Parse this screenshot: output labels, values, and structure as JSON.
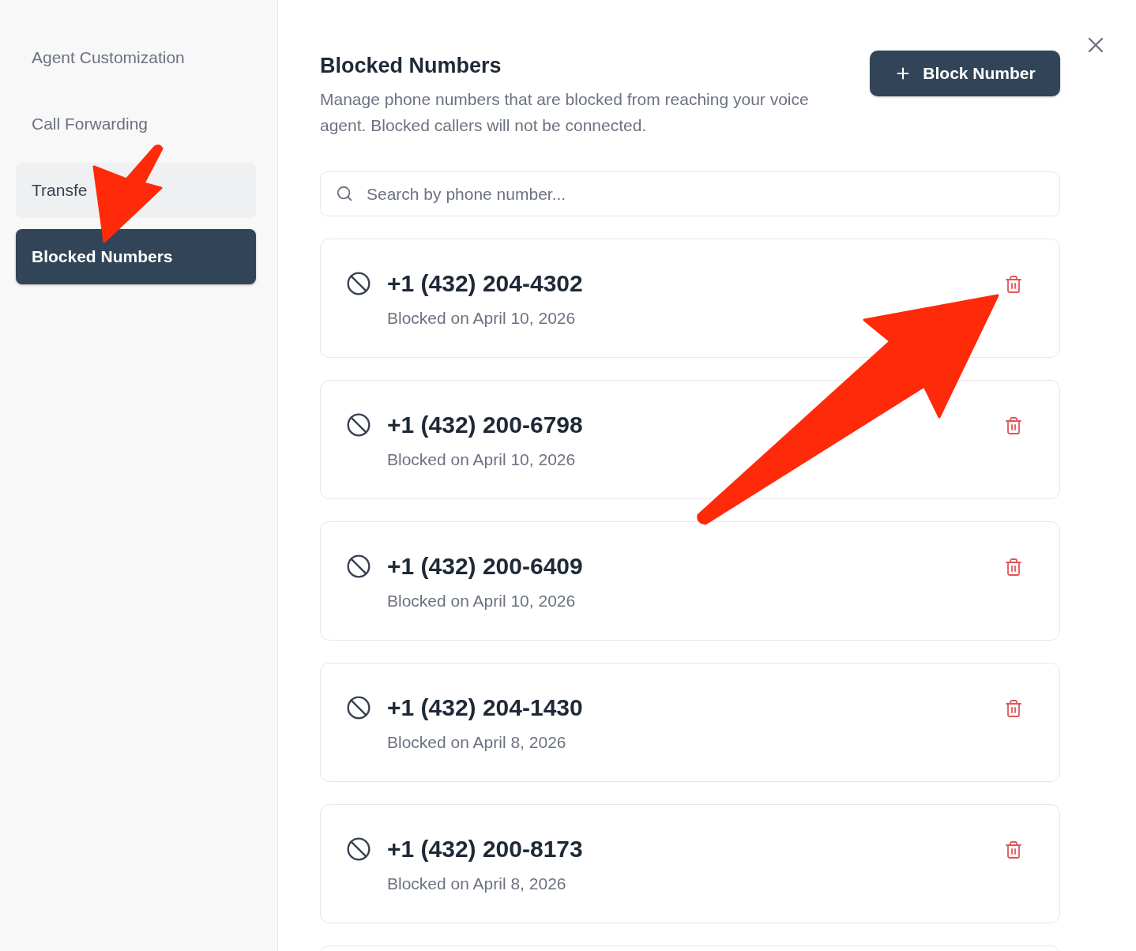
{
  "sidebar": {
    "items": [
      {
        "label": "Agent Customization",
        "selected": false,
        "hovered": false
      },
      {
        "label": "Call Forwarding",
        "selected": false,
        "hovered": false
      },
      {
        "label": "Transfe",
        "selected": false,
        "hovered": true
      },
      {
        "label": "Blocked Numbers",
        "selected": true,
        "hovered": false
      }
    ]
  },
  "header": {
    "title": "Blocked Numbers",
    "description": "Manage phone numbers that are blocked from reaching your voice agent. Blocked callers will not be connected.",
    "button": "Block Number"
  },
  "search": {
    "placeholder": "Search by phone number..."
  },
  "blocked_numbers": [
    {
      "number": "+1 (432) 204-4302",
      "date": "Blocked on April 10, 2026"
    },
    {
      "number": "+1 (432) 200-6798",
      "date": "Blocked on April 10, 2026"
    },
    {
      "number": "+1 (432) 200-6409",
      "date": "Blocked on April 10, 2026"
    },
    {
      "number": "+1 (432) 204-1430",
      "date": "Blocked on April 8, 2026"
    },
    {
      "number": "+1 (432) 200-8173",
      "date": "Blocked on April 8, 2026"
    }
  ],
  "annotations": [
    {
      "kind": "arrow"
    },
    {
      "kind": "arrow"
    }
  ]
}
